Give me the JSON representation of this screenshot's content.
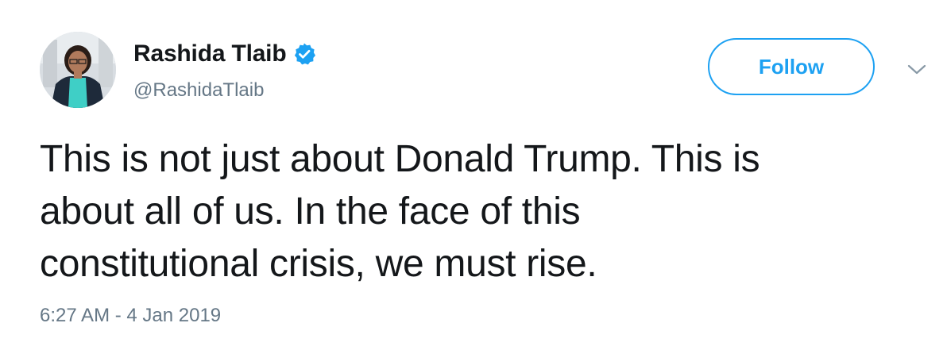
{
  "author": {
    "display_name": "Rashida Tlaib",
    "handle": "@RashidaTlaib",
    "verified": true
  },
  "actions": {
    "follow_label": "Follow"
  },
  "tweet": {
    "lines": [
      "This is not just about Donald Trump. This is",
      "about all of us. In the face of this",
      "constitutional crisis, we must rise."
    ],
    "timestamp": "6:27 AM - 4 Jan 2019"
  },
  "colors": {
    "accent": "#1da1f2",
    "text": "#14171a",
    "secondary_text": "#657786"
  },
  "icons": {
    "verified": "verified-badge-icon",
    "menu": "chevron-down-icon",
    "avatar": "profile-photo"
  }
}
